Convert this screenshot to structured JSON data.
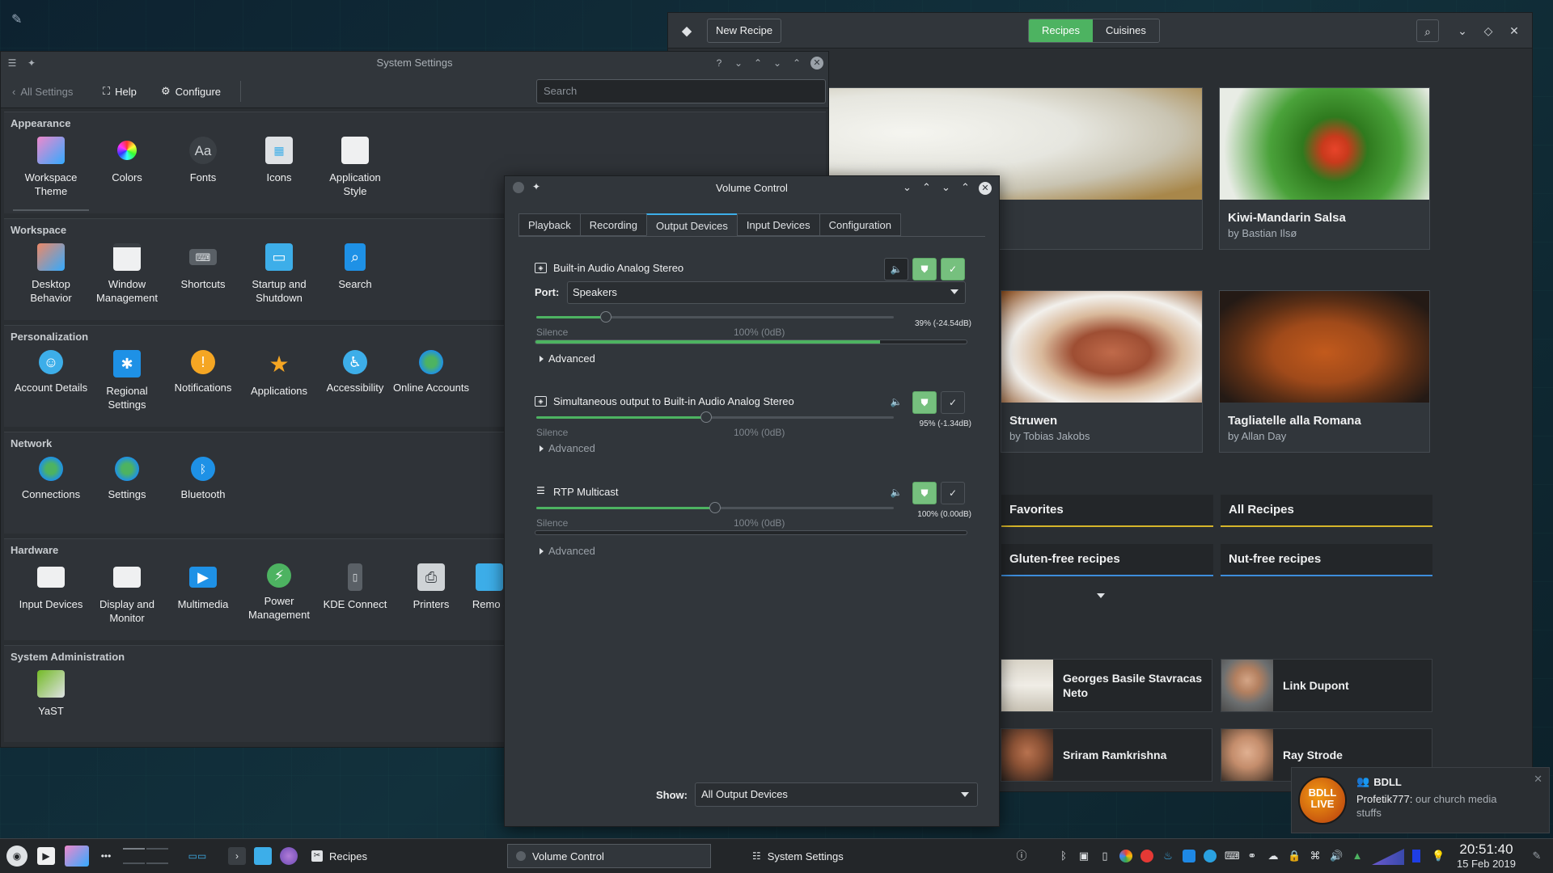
{
  "recipes": {
    "new_recipe": "New Recipe",
    "tabs": [
      "Recipes",
      "Cuisines"
    ],
    "cards": [
      {
        "title": "",
        "by": ""
      },
      {
        "title": "Kiwi-Mandarin Salsa",
        "by": "by Bastian Ilsø"
      },
      {
        "title": "Struwen",
        "by": "by Tobias Jakobs"
      },
      {
        "title": "Tagliatelle alla Romana",
        "by": "by Allan Day"
      }
    ],
    "categories": [
      "Favorites",
      "All Recipes",
      "Gluten-free recipes",
      "Nut-free recipes"
    ],
    "chefs": [
      "Georges Basile Stavracas Neto",
      "Link Dupont",
      "Sriram Ramkrishna",
      "Ray Strode"
    ]
  },
  "settings": {
    "title": "System Settings",
    "toolbar": {
      "all_settings": "All Settings",
      "help": "Help",
      "configure": "Configure"
    },
    "search_placeholder": "Search",
    "sections": [
      {
        "name": "Appearance",
        "items": [
          "Workspace Theme",
          "Colors",
          "Fonts",
          "Icons",
          "Application Style"
        ]
      },
      {
        "name": "Workspace",
        "items": [
          "Desktop Behavior",
          "Window Management",
          "Shortcuts",
          "Startup and Shutdown",
          "Search"
        ]
      },
      {
        "name": "Personalization",
        "items": [
          "Account Details",
          "Regional Settings",
          "Notifications",
          "Applications",
          "Accessibility",
          "Online Accounts"
        ]
      },
      {
        "name": "Network",
        "items": [
          "Connections",
          "Settings",
          "Bluetooth"
        ]
      },
      {
        "name": "Hardware",
        "items": [
          "Input Devices",
          "Display and Monitor",
          "Multimedia",
          "Power Management",
          "KDE Connect",
          "Printers",
          "Remo Stor"
        ]
      },
      {
        "name": "System Administration",
        "items": [
          "YaST"
        ]
      }
    ]
  },
  "volume": {
    "title": "Volume Control",
    "tabs": [
      "Playback",
      "Recording",
      "Output Devices",
      "Input Devices",
      "Configuration"
    ],
    "port_label": "Port:",
    "port_value": "Speakers",
    "silence": "Silence",
    "hundred": "100% (0dB)",
    "advanced": "Advanced",
    "devices": [
      {
        "name": "Built-in Audio Analog Stereo",
        "percent": "39% (-24.54dB)",
        "volume": 0.39,
        "level": 0.8
      },
      {
        "name": "Simultaneous output to Built-in Audio Analog Stereo",
        "percent": "95% (-1.34dB)",
        "volume": 0.95,
        "level": 0
      },
      {
        "name": "RTP Multicast",
        "percent": "100% (0.00dB)",
        "volume": 1.0,
        "level": 0
      }
    ],
    "show_label": "Show:",
    "show_value": "All Output Devices"
  },
  "notification": {
    "app": "BDLL",
    "avatar_text": "BDLL LIVE",
    "sender": "Profetik777:",
    "message": "our church media stuffs"
  },
  "taskbar": {
    "tasks": [
      "Recipes",
      "Volume Control",
      "System Settings"
    ],
    "time": "20:51:40",
    "date": "15 Feb 2019"
  },
  "colors": {
    "accent_green": "#4db361",
    "highlight": "#3daee9",
    "panel": "#31363b"
  }
}
